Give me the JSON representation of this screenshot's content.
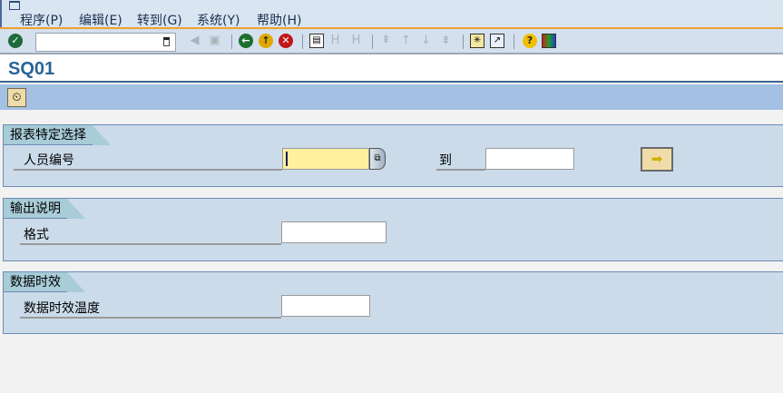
{
  "menu": {
    "items": [
      "程序(P)",
      "编辑(E)",
      "转到(G)",
      "系统(Y)",
      "帮助(H)"
    ]
  },
  "toolbar": {
    "command_field": "",
    "icons": [
      "enter-icon",
      "back-nav-icon",
      "save-icon",
      "back-icon",
      "exit-icon",
      "cancel-icon",
      "print-icon",
      "find-icon",
      "find-next-icon",
      "first-page-icon",
      "previous-page-icon",
      "next-page-icon",
      "last-page-icon",
      "new-session-icon",
      "shortcut-icon",
      "help-icon",
      "customize-layout-icon"
    ]
  },
  "title": "SQ01",
  "groups": [
    {
      "title": "报表特定选择",
      "fields": [
        {
          "label": "人员编号",
          "value": "",
          "to_label": "到",
          "to_value": ""
        }
      ]
    },
    {
      "title": "输出说明",
      "fields": [
        {
          "label": "格式",
          "value": ""
        }
      ]
    },
    {
      "title": "数据时效",
      "fields": [
        {
          "label": "数据时效温度",
          "value": ""
        }
      ]
    }
  ]
}
